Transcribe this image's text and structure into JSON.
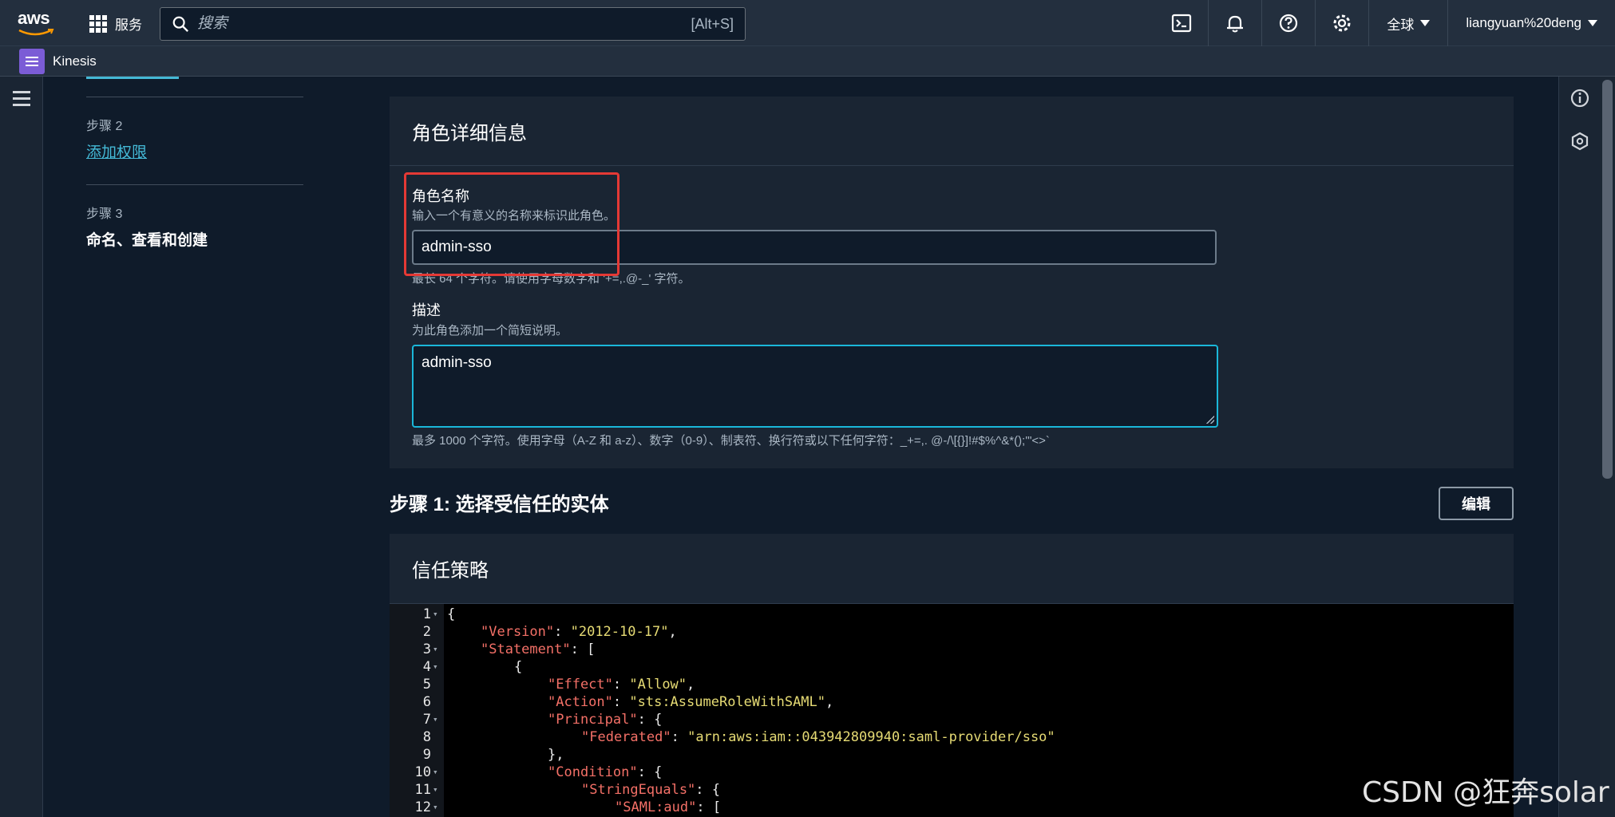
{
  "topnav": {
    "brand": "aws",
    "services_label": "服务",
    "search_placeholder": "搜索",
    "search_shortcut": "[Alt+S]",
    "region_label": "全球",
    "user_label": "liangyuan%20deng"
  },
  "servicebar": {
    "service_name": "Kinesis"
  },
  "steps": {
    "step2_num": "步骤 2",
    "step2_label": "添加权限",
    "step3_num": "步骤 3",
    "step3_label": "命名、查看和创建"
  },
  "role_details": {
    "title": "角色详细信息",
    "name_label": "角色名称",
    "name_desc": "输入一个有意义的名称来标识此角色。",
    "name_value": "admin-sso",
    "name_hint": "最长 64 个字符。请使用字母数字和 '+=,.@-_' 字符。",
    "desc_label": "描述",
    "desc_desc": "为此角色添加一个简短说明。",
    "desc_value": "admin-sso",
    "desc_hint": "最多 1000 个字符。使用字母（A-Z 和 a-z）、数字（0-9）、制表符、换行符或以下任何字符：_+=,. @-/\\[{}]!#$%^&*();'\"<>`"
  },
  "step1": {
    "title": "步骤 1: 选择受信任的实体",
    "edit_label": "编辑"
  },
  "trust_policy": {
    "title": "信任策略",
    "lines": [
      {
        "n": "1",
        "fold": true
      },
      {
        "n": "2",
        "fold": false
      },
      {
        "n": "3",
        "fold": true
      },
      {
        "n": "4",
        "fold": true
      },
      {
        "n": "5",
        "fold": false
      },
      {
        "n": "6",
        "fold": false
      },
      {
        "n": "7",
        "fold": true
      },
      {
        "n": "8",
        "fold": false
      },
      {
        "n": "9",
        "fold": false
      },
      {
        "n": "10",
        "fold": true
      },
      {
        "n": "11",
        "fold": true
      },
      {
        "n": "12",
        "fold": true
      }
    ],
    "tokens": {
      "version_key": "\"Version\"",
      "version_val": "\"2012-10-17\"",
      "statement_key": "\"Statement\"",
      "effect_key": "\"Effect\"",
      "effect_val": "\"Allow\"",
      "action_key": "\"Action\"",
      "action_val": "\"sts:AssumeRoleWithSAML\"",
      "principal_key": "\"Principal\"",
      "federated_key": "\"Federated\"",
      "federated_val": "\"arn:aws:iam::043942809940:saml-provider/sso\"",
      "condition_key": "\"Condition\"",
      "stringequals_key": "\"StringEquals\"",
      "samlaud_key": "\"SAML:aud\""
    }
  },
  "watermark": "CSDN @狂奔solar",
  "colors": {
    "accent": "#44b9d6",
    "highlight": "#e53935",
    "nav_bg": "#232f3e",
    "page_bg": "#0f1b2a"
  }
}
